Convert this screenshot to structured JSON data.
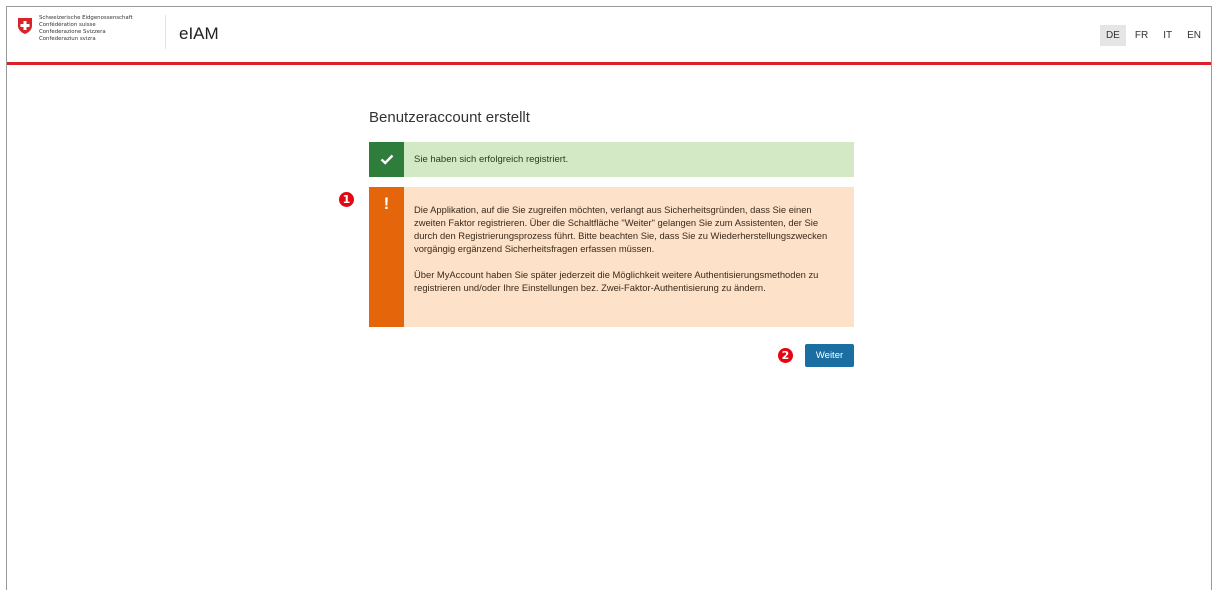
{
  "header": {
    "confederation_lines": [
      "Schweizerische Eidgenossenschaft",
      "Confédération suisse",
      "Confederazione Svizzera",
      "Confederaziun svizra"
    ],
    "app_title": "eIAM",
    "languages": [
      "DE",
      "FR",
      "IT",
      "EN"
    ],
    "active_language": "DE"
  },
  "main": {
    "title": "Benutzeraccount erstellt",
    "success_message": "Sie haben sich erfolgreich registriert.",
    "warning_paragraph_1": "Die Applikation, auf die Sie zugreifen möchten, verlangt aus Sicherheitsgründen, dass Sie einen zweiten Faktor registrieren. Über die Schaltfläche \"Weiter\" gelangen Sie zum Assistenten, der Sie durch den Registrierungsprozess führt. Bitte beachten Sie, dass Sie zu Wiederherstellungszwecken vorgängig ergänzend Sicherheitsfragen erfassen müssen.",
    "warning_paragraph_2": "Über MyAccount haben Sie später jederzeit die Möglichkeit weitere Authentisierungsmethoden zu registrieren und/oder Ihre Einstellungen bez. Zwei-Faktor-Authentisierung zu ändern.",
    "continue_label": "Weiter"
  },
  "annotations": {
    "marker_1": "1",
    "marker_2": "2"
  },
  "colors": {
    "accent_red": "#d8232a",
    "success_bg": "#d3e9c6",
    "success_icon": "#2f7d3a",
    "warning_bg": "#fde1c8",
    "warning_icon": "#e4650a",
    "button": "#1a6ea1"
  }
}
